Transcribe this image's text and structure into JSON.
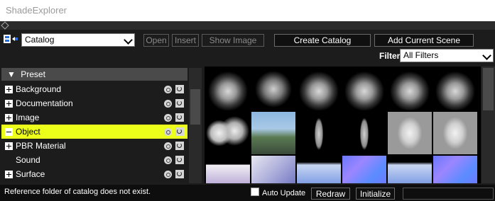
{
  "window": {
    "title": "ShadeExplorer"
  },
  "toolbar": {
    "catalog_select": "Catalog",
    "open_label": "Open",
    "insert_label": "Insert",
    "show_image_label": "Show Image",
    "create_catalog_label": "Create Catalog",
    "add_current_scene_label": "Add Current Scene",
    "filter_label": "Filter",
    "filter_select": "All Filters"
  },
  "tree": {
    "header": "Preset",
    "items": [
      {
        "label": "Background",
        "expander": "plus"
      },
      {
        "label": "Documentation",
        "expander": "plus"
      },
      {
        "label": "Image",
        "expander": "plus"
      },
      {
        "label": "Object",
        "expander": "minus",
        "selected": true
      },
      {
        "label": "PBR Material",
        "expander": "plus"
      },
      {
        "label": "Sound",
        "expander": "none"
      },
      {
        "label": "Surface",
        "expander": "plus"
      }
    ]
  },
  "gallery": {
    "thumbnails": [
      "smoke-cloud",
      "smoke-ball",
      "smoke-cloud",
      "smoke-cloud",
      "smoke-cloud",
      "smoke-cloud",
      "cloud-puffs",
      "building-scene",
      "human-figure",
      "human-figure",
      "bust-statue",
      "bust-statue",
      "blocks-row",
      "robot-arm",
      "gradient-plane",
      "normal-map",
      "gradient-plane",
      "normal-map"
    ]
  },
  "status": {
    "message": "Reference folder of catalog does not exist.",
    "auto_update_label": "Auto Update",
    "redraw_label": "Redraw",
    "initialize_label": "Initialize"
  },
  "colors": {
    "selected_row": "#ebff1b",
    "background": "#1c1c1c"
  }
}
